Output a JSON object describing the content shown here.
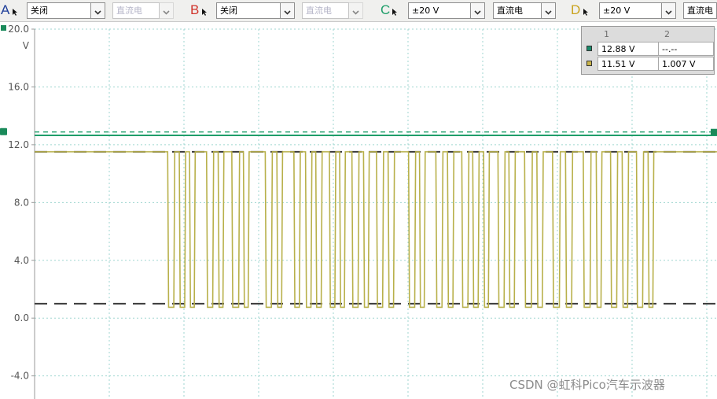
{
  "toolbar": {
    "channels": [
      {
        "letter": "A",
        "color": "#1f3f9a",
        "range": "关闭",
        "coupling": "直流电",
        "coupling_disabled": true
      },
      {
        "letter": "B",
        "color": "#d0342c",
        "range": "关闭",
        "coupling": "直流电",
        "coupling_disabled": true
      },
      {
        "letter": "C",
        "color": "#1f9e6a",
        "range": "±20 V",
        "coupling": "直流电",
        "coupling_disabled": false
      },
      {
        "letter": "D",
        "color": "#c9a21c",
        "range": "±20 V",
        "coupling": "直流电",
        "coupling_disabled": false
      }
    ]
  },
  "measurements": {
    "headers": [
      "1",
      "2"
    ],
    "rows": [
      {
        "swatch": "#1a8a6a",
        "col1": "12.88 V",
        "col2": "--.--"
      },
      {
        "swatch": "#c9b44a",
        "col1": "11.51 V",
        "col2": "1.007 V"
      }
    ]
  },
  "watermark": "CSDN @虹科Pico汽车示波器",
  "colors": {
    "grid": "#9fd6d0",
    "channel_c": "#1f9e6a",
    "channel_d": "#b8b04a",
    "marker": "#1a8a5a"
  },
  "chart_data": {
    "type": "line",
    "title": "",
    "xlabel": "",
    "ylabel": "",
    "y_unit": "V",
    "ylim": [
      -5.6,
      20.0
    ],
    "yticks": [
      {
        "value": 20.0,
        "label": "20.0"
      },
      {
        "value": 16.0,
        "label": "16.0"
      },
      {
        "value": 12.0,
        "label": "12.0"
      },
      {
        "value": 8.0,
        "label": "8.0"
      },
      {
        "value": 4.0,
        "label": "4.0"
      },
      {
        "value": 0.0,
        "label": "0.0"
      },
      {
        "value": -4.0,
        "label": "-4.0"
      }
    ],
    "x_gridlines": 9,
    "grid": true,
    "cursor_lines": [
      {
        "value": 11.51,
        "style": "dash-dark"
      },
      {
        "value": 1.0,
        "style": "dash-dark"
      },
      {
        "value": 12.88,
        "style": "dash-green"
      }
    ],
    "series": [
      {
        "channel": "C",
        "color": "#1f9e6a",
        "level": 12.65
      },
      {
        "channel": "D",
        "color": "#b8b04a",
        "high": 11.51,
        "low": 0.75,
        "x_range": [
          0,
          100
        ],
        "high_until": 19.0,
        "high_after": 90.9,
        "low_pulses": [
          [
            19.5,
            20.4
          ],
          [
            21.2,
            22.0
          ],
          [
            22.7,
            23.4
          ],
          [
            25.2,
            26.1
          ],
          [
            26.9,
            27.6
          ],
          [
            28.9,
            29.9
          ],
          [
            30.6,
            31.3
          ],
          [
            33.8,
            34.7
          ],
          [
            35.5,
            36.2
          ],
          [
            38.0,
            38.8
          ],
          [
            39.7,
            40.5
          ],
          [
            41.2,
            42.0
          ],
          [
            43.2,
            44.0
          ],
          [
            44.7,
            45.4
          ],
          [
            46.5,
            47.4
          ],
          [
            48.2,
            48.9
          ],
          [
            50.1,
            51.0
          ],
          [
            51.8,
            52.6
          ],
          [
            54.8,
            55.7
          ],
          [
            56.4,
            57.1
          ],
          [
            58.8,
            59.7
          ],
          [
            60.5,
            61.3
          ],
          [
            62.6,
            63.5
          ],
          [
            64.2,
            65.0
          ],
          [
            65.8,
            66.5
          ],
          [
            67.9,
            68.8
          ],
          [
            69.5,
            70.3
          ],
          [
            71.8,
            72.8
          ],
          [
            73.6,
            74.4
          ],
          [
            75.9,
            76.9
          ],
          [
            77.8,
            78.7
          ],
          [
            80.4,
            81.4
          ],
          [
            82.3,
            83.0
          ],
          [
            84.4,
            85.3
          ],
          [
            86.1,
            86.9
          ],
          [
            88.2,
            89.1
          ],
          [
            89.9,
            90.6
          ]
        ]
      }
    ]
  }
}
